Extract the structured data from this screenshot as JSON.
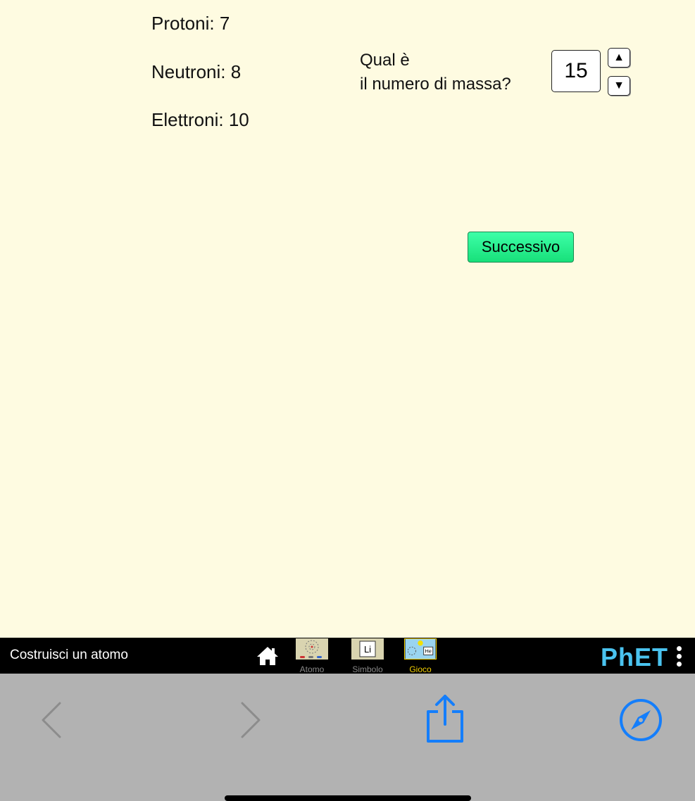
{
  "info": {
    "protons": "Protoni: 7",
    "neutrons": "Neutroni: 8",
    "electrons": "Elettroni: 10"
  },
  "question": {
    "line1": "Qual è",
    "line2": "il numero di massa?",
    "value": "15",
    "up_glyph": "▲",
    "down_glyph": "▼"
  },
  "next_button": {
    "label": "Successivo"
  },
  "navbar": {
    "title": "Costruisci un atomo",
    "tabs": [
      {
        "label": "Atomo",
        "selected": false
      },
      {
        "label": "Simbolo",
        "selected": false
      },
      {
        "label": "Gioco",
        "selected": true
      }
    ],
    "symbol_thumb_text": "Li",
    "game_thumb_text": "He",
    "logo": "PhET"
  },
  "browser": {
    "icons": [
      "back-icon",
      "forward-icon",
      "share-icon",
      "compass-icon"
    ]
  },
  "colors": {
    "sim_background": "#fefbe1",
    "button_green": "#2bf08f",
    "navbar": "#000000",
    "selected_tab": "#f3d000",
    "browser_blue": "#147efb"
  }
}
